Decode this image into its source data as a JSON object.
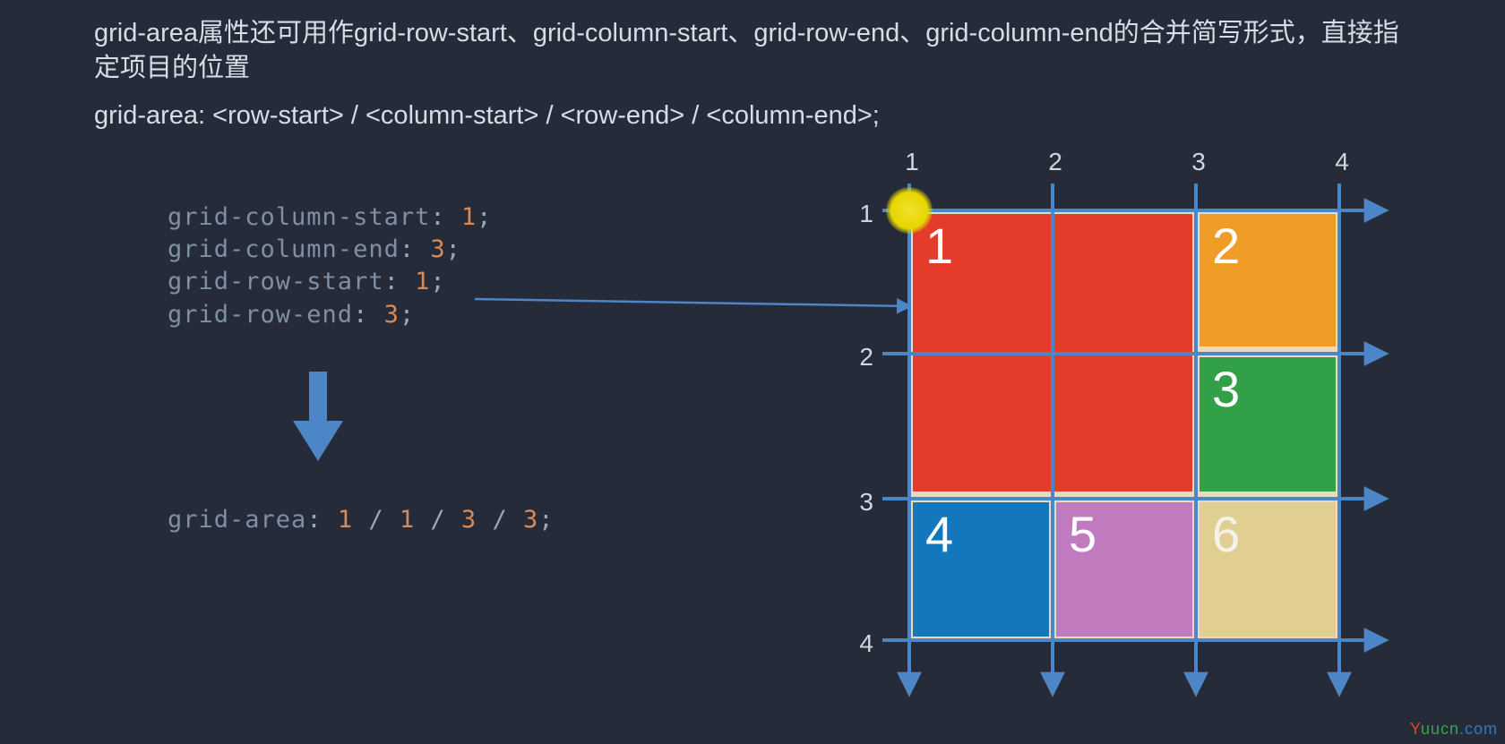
{
  "paragraphs": {
    "p1": "grid-area属性还可用作grid-row-start、grid-column-start、grid-row-end、grid-column-end的合并简写形式，直接指定项目的位置",
    "p2": "grid-area: <row-start> / <column-start> / <row-end> / <column-end>;"
  },
  "code": {
    "lines": [
      {
        "prop": "grid-column-start",
        "value": "1"
      },
      {
        "prop": "grid-column-end",
        "value": "3"
      },
      {
        "prop": "grid-row-start",
        "value": "1"
      },
      {
        "prop": "grid-row-end",
        "value": "3"
      }
    ],
    "short": {
      "prop": "grid-area",
      "values": [
        "1",
        "1",
        "3",
        "3"
      ]
    }
  },
  "grid": {
    "col_labels": [
      "1",
      "2",
      "3",
      "4"
    ],
    "row_labels": [
      "1",
      "2",
      "3",
      "4"
    ],
    "cells": [
      {
        "label": "1",
        "class": "c1"
      },
      {
        "label": "2",
        "class": "c2"
      },
      {
        "label": "3",
        "class": "c3"
      },
      {
        "label": "4",
        "class": "c4"
      },
      {
        "label": "5",
        "class": "c5"
      },
      {
        "label": "6",
        "class": "c6"
      }
    ]
  },
  "colors": {
    "grid_line": "#4d86c6",
    "arrow": "#4d86c6"
  },
  "watermark": {
    "y": "Y",
    "uucn": "uucn",
    "com": ".com"
  },
  "chart_data": {
    "type": "table",
    "description": "CSS grid 3x3 with item 1 spanning rows 1-3 and columns 1-3 (grid-area:1/1/3/3)",
    "grid_lines": {
      "columns": [
        1,
        2,
        3,
        4
      ],
      "rows": [
        1,
        2,
        3,
        4
      ]
    },
    "items": [
      {
        "n": 1,
        "row_start": 1,
        "col_start": 1,
        "row_end": 3,
        "col_end": 3,
        "color": "#e53b2b"
      },
      {
        "n": 2,
        "row_start": 1,
        "col_start": 3,
        "row_end": 2,
        "col_end": 4,
        "color": "#ef9d26"
      },
      {
        "n": 3,
        "row_start": 2,
        "col_start": 3,
        "row_end": 3,
        "col_end": 4,
        "color": "#31a047"
      },
      {
        "n": 4,
        "row_start": 3,
        "col_start": 1,
        "row_end": 4,
        "col_end": 2,
        "color": "#1277bd"
      },
      {
        "n": 5,
        "row_start": 3,
        "col_start": 2,
        "row_end": 4,
        "col_end": 3,
        "color": "#c07bbf"
      },
      {
        "n": 6,
        "row_start": 3,
        "col_start": 3,
        "row_end": 4,
        "col_end": 4,
        "color": "#e0cf91"
      }
    ],
    "example_property": "grid-area: 1 / 1 / 3 / 3;"
  }
}
